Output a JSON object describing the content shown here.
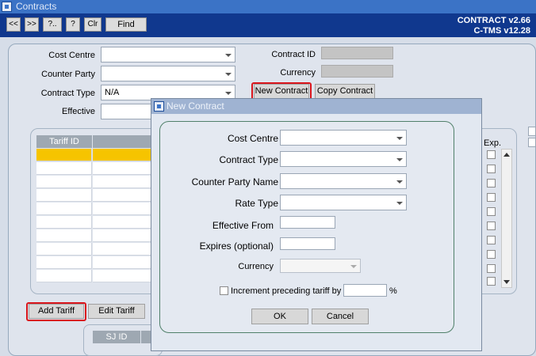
{
  "window": {
    "title": "Contracts"
  },
  "toolbar": {
    "buttons": [
      "<<",
      ">>",
      "?..",
      "?",
      "Clr",
      "Find"
    ],
    "version_line1": "CONTRACT v2.66",
    "version_line2": "C-TMS v12.28"
  },
  "form": {
    "cost_centre_label": "Cost Centre",
    "counter_party_label": "Counter Party",
    "contract_type_label": "Contract Type",
    "contract_type_value": "N/A",
    "effective_label": "Effective",
    "contract_id_label": "Contract ID",
    "currency_label": "Currency",
    "new_contract_label": "New Contract",
    "copy_contract_label": "Copy Contract"
  },
  "tariff_grid": {
    "col_tariff_id": "Tariff ID",
    "col_exp": "Exp."
  },
  "actions": {
    "add_tariff_label": "Add Tariff",
    "edit_tariff_label": "Edit Tariff"
  },
  "sj_grid": {
    "col_sj_id": "SJ ID"
  },
  "dialog": {
    "title": "New Contract",
    "cost_centre_label": "Cost Centre",
    "contract_type_label": "Contract Type",
    "counter_party_name_label": "Counter Party Name",
    "rate_type_label": "Rate Type",
    "effective_from_label": "Effective From",
    "expires_label": "Expires (optional)",
    "currency_label": "Currency",
    "increment_label": "Increment preceding tariff by",
    "percent_sign": "%",
    "ok_label": "OK",
    "cancel_label": "Cancel"
  },
  "colors": {
    "titlebar": "#3b73c6",
    "toolbar": "#10388e",
    "highlight": "#d9151b",
    "selected_row": "#f6c400"
  }
}
